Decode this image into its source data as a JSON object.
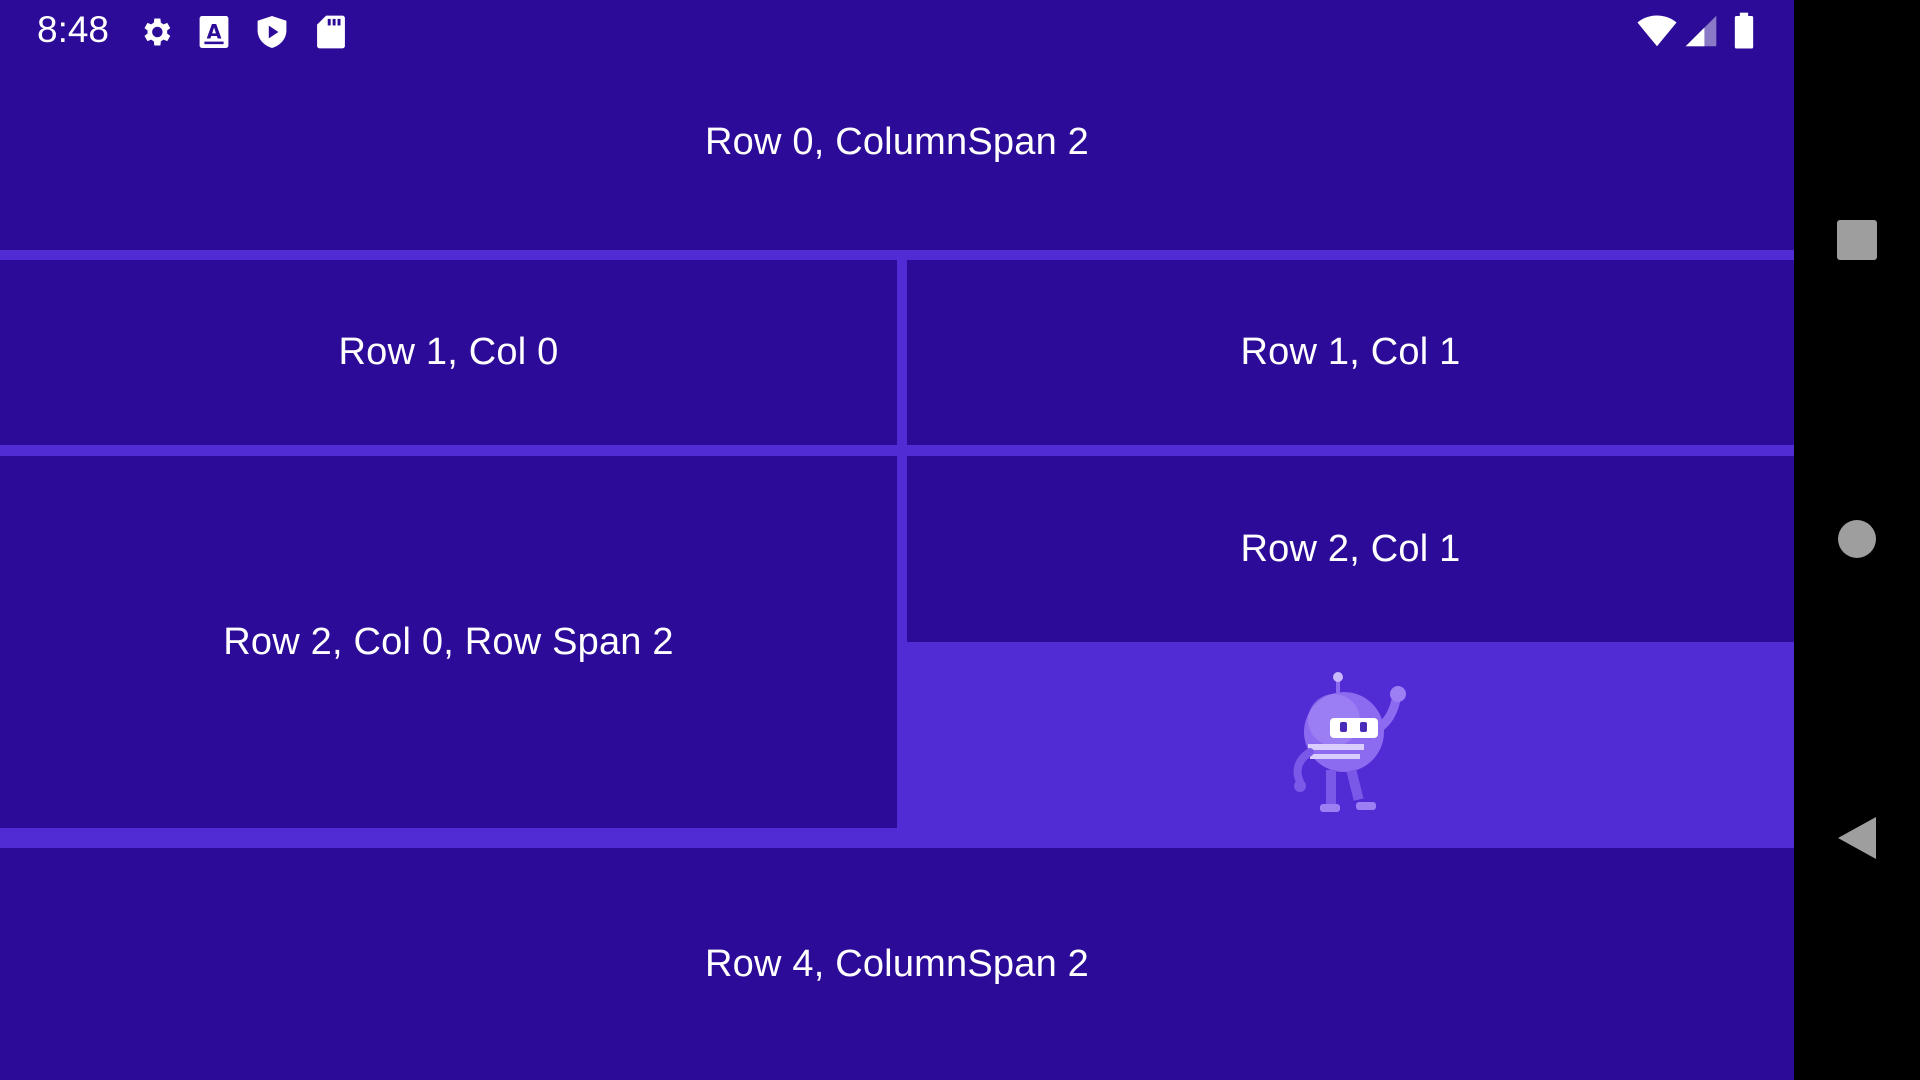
{
  "status_bar": {
    "time": "8:48",
    "left_icons": [
      "settings-icon",
      "text-a-icon",
      "shield-play-icon",
      "sd-card-icon"
    ],
    "right_icons": [
      "wifi-icon",
      "cell-signal-icon",
      "battery-icon"
    ]
  },
  "grid": {
    "row0": "Row 0, ColumnSpan 2",
    "row1_col0": "Row 1, Col 0",
    "row1_col1": "Row 1, Col 1",
    "row2_col0": "Row 2, Col 0, Row Span 2",
    "row2_col1": "Row 2, Col 1",
    "row4": "Row 4, ColumnSpan 2"
  },
  "image": {
    "icon": "dotnet-bot-icon"
  },
  "nav_bar": {
    "buttons": [
      "recents-square-icon",
      "home-circle-icon",
      "back-triangle-icon"
    ]
  },
  "colors": {
    "cell_background": "#2B0B98",
    "grid_background": "#512BD4",
    "text": "#FFFFFF",
    "nav_background": "#000000",
    "nav_icon": "#9E9E9E"
  }
}
